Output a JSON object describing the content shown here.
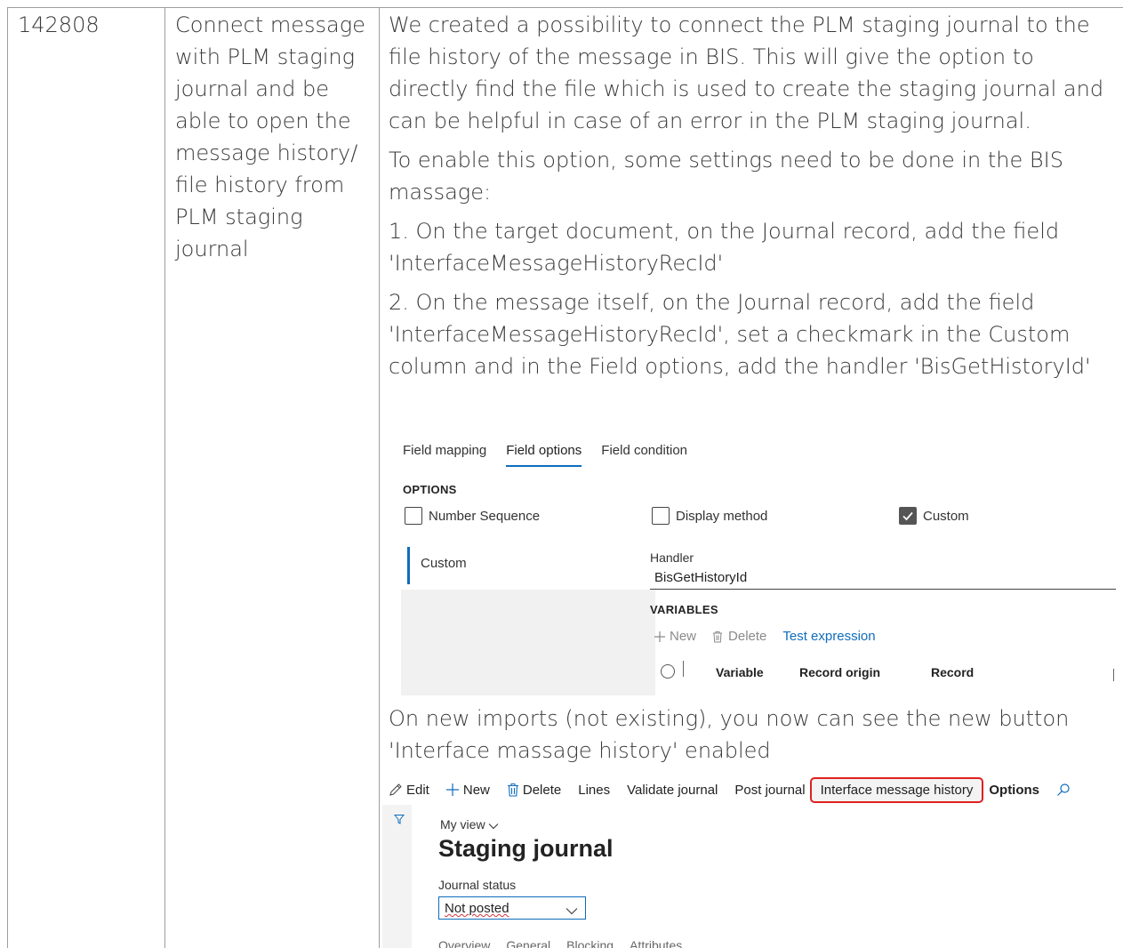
{
  "row": {
    "id": "142808",
    "title": "Connect message with PLM staging journal and be able to open the message history/ file history from PLM staging journal",
    "title_lines": [
      "Connect message",
      "with PLM staging",
      "journal and be",
      "able to open the",
      "message history/",
      "file history from",
      "PLM staging",
      "journal"
    ],
    "p1": "We created a possibility to connect the PLM staging journal to the file history of the message in BIS. This will give the option to directly find the file which is used to create the staging journal and can be helpful in case of an error in the PLM staging journal.",
    "p2": "To enable this option, some settings need to be done in the BIS massage:",
    "p3": "1. On the target document, on the Journal record, add the field 'InterfaceMessageHistoryRecId'",
    "p4": "2. On the message itself, on the Journal record, add the field 'InterfaceMessageHistoryRecId', set a checkmark in the Custom column and in the Field options, add the handler 'BisGetHistoryId'",
    "p5": "On new imports (not existing), you now can see the new button 'Interface massage history' enabled"
  },
  "field_options_shot": {
    "tabs": [
      "Field mapping",
      "Field options",
      "Field condition"
    ],
    "active_tab": "Field options",
    "options_title": "OPTIONS",
    "checkboxes": [
      {
        "label": "Number Sequence",
        "checked": false
      },
      {
        "label": "Display method",
        "checked": false
      },
      {
        "label": "Custom",
        "checked": true
      }
    ],
    "list_item": "Custom",
    "handler_label": "Handler",
    "handler_value": "BisGetHistoryId",
    "variables_title": "VARIABLES",
    "tools": {
      "new": "New",
      "delete": "Delete",
      "test": "Test expression"
    },
    "columns": [
      "Variable",
      "Record origin",
      "Record"
    ]
  },
  "staging_shot": {
    "actions": {
      "edit": "Edit",
      "new": "New",
      "delete": "Delete",
      "lines": "Lines",
      "validate": "Validate journal",
      "post": "Post journal",
      "history": "Interface message history",
      "options": "Options"
    },
    "my_view": "My view",
    "title": "Staging journal",
    "status_label": "Journal status",
    "status_value": "Not posted",
    "tabs": [
      "Overview",
      "General",
      "Blocking",
      "Attributes"
    ]
  },
  "colors": {
    "accent": "#0f6cbd",
    "highlight_border": "#e02020",
    "border": "#9e9e9e"
  }
}
